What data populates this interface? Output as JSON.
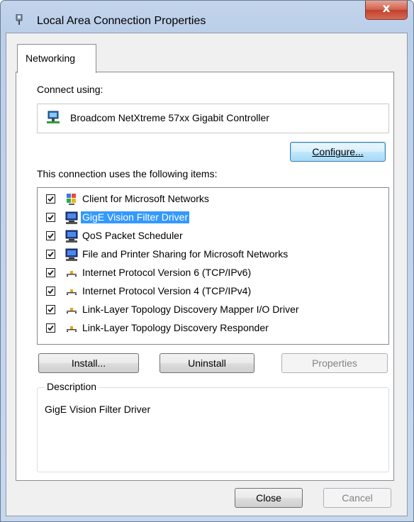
{
  "window": {
    "title": "Local Area Connection Properties",
    "close_glyph": "x",
    "title_icon": "network-plug-icon"
  },
  "tabs": [
    {
      "label": "Networking",
      "selected": true
    }
  ],
  "connect_using": {
    "label": "Connect using:",
    "adapter_name": "Broadcom NetXtreme 57xx Gigabit Controller",
    "adapter_icon": "network-adapter-icon",
    "configure_label": "Configure..."
  },
  "items_section": {
    "label": "This connection uses the following items:",
    "items": [
      {
        "label": "Client for Microsoft Networks",
        "checked": true,
        "icon": "network-client-icon",
        "selected": false
      },
      {
        "label": "GigE Vision Filter Driver",
        "checked": true,
        "icon": "network-service-icon",
        "selected": true
      },
      {
        "label": "QoS Packet Scheduler",
        "checked": true,
        "icon": "network-service-icon",
        "selected": false
      },
      {
        "label": "File and Printer Sharing for Microsoft Networks",
        "checked": true,
        "icon": "network-service-icon",
        "selected": false
      },
      {
        "label": "Internet Protocol Version 6 (TCP/IPv6)",
        "checked": true,
        "icon": "protocol-icon",
        "selected": false
      },
      {
        "label": "Internet Protocol Version 4 (TCP/IPv4)",
        "checked": true,
        "icon": "protocol-icon",
        "selected": false
      },
      {
        "label": "Link-Layer Topology Discovery Mapper I/O Driver",
        "checked": true,
        "icon": "protocol-icon",
        "selected": false
      },
      {
        "label": "Link-Layer Topology Discovery Responder",
        "checked": true,
        "icon": "protocol-icon",
        "selected": false
      }
    ]
  },
  "actions": {
    "install_label": "Install...",
    "uninstall_label": "Uninstall",
    "properties_label": "Properties",
    "properties_enabled": false
  },
  "description": {
    "legend": "Description",
    "text": "GigE Vision Filter Driver"
  },
  "footer": {
    "close_label": "Close",
    "cancel_label": "Cancel",
    "cancel_enabled": false
  },
  "colors": {
    "selection": "#3399ff",
    "title_close_red": "#c0412d",
    "frame_blue": "#bccfe9"
  }
}
